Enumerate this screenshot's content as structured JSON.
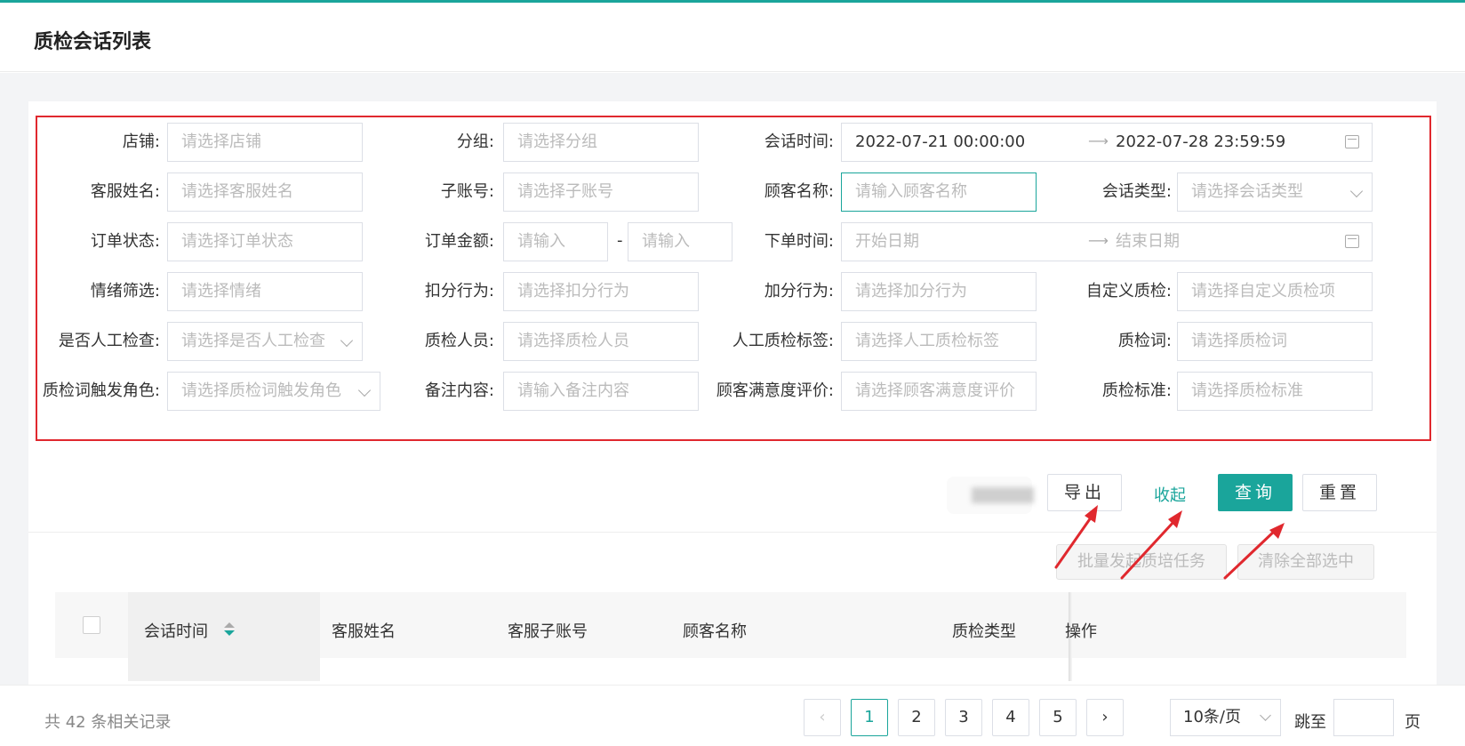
{
  "page": {
    "title": "质检会话列表"
  },
  "filters": [
    {
      "id": "shop",
      "label": "店铺:",
      "placeholder": "请选择店铺"
    },
    {
      "id": "group",
      "label": "分组:",
      "placeholder": "请选择分组"
    },
    {
      "id": "session_time",
      "label": "会话时间:",
      "start": "2022-07-21 00:00:00",
      "end": "2022-07-28 23:59:59"
    },
    {
      "id": "agent_name",
      "label": "客服姓名:",
      "placeholder": "请选择客服姓名"
    },
    {
      "id": "sub_account",
      "label": "子账号:",
      "placeholder": "请选择子账号"
    },
    {
      "id": "customer_name",
      "label": "顾客名称:",
      "placeholder": "请输入顾客名称"
    },
    {
      "id": "session_type",
      "label": "会话类型:",
      "placeholder": "请选择会话类型"
    },
    {
      "id": "order_status",
      "label": "订单状态:",
      "placeholder": "请选择订单状态"
    },
    {
      "id": "order_amount",
      "label": "订单金额:",
      "min_placeholder": "请输入",
      "max_placeholder": "请输入",
      "sep": "-"
    },
    {
      "id": "order_time",
      "label": "下单时间:",
      "start_placeholder": "开始日期",
      "end_placeholder": "结束日期"
    },
    {
      "id": "emotion",
      "label": "情绪筛选:",
      "placeholder": "请选择情绪"
    },
    {
      "id": "deduct",
      "label": "扣分行为:",
      "placeholder": "请选择扣分行为"
    },
    {
      "id": "bonus",
      "label": "加分行为:",
      "placeholder": "请选择加分行为"
    },
    {
      "id": "custom_qc",
      "label": "自定义质检:",
      "placeholder": "请选择自定义质检项"
    },
    {
      "id": "manual_check",
      "label": "是否人工检查:",
      "placeholder": "请选择是否人工检查"
    },
    {
      "id": "qc_staff",
      "label": "质检人员:",
      "placeholder": "请选择质检人员"
    },
    {
      "id": "manual_tag",
      "label": "人工质检标签:",
      "placeholder": "请选择人工质检标签"
    },
    {
      "id": "qc_word",
      "label": "质检词:",
      "placeholder": "请选择质检词"
    },
    {
      "id": "trigger_role",
      "label": "质检词触发角色:",
      "placeholder": "请选择质检词触发角色"
    },
    {
      "id": "remark",
      "label": "备注内容:",
      "placeholder": "请输入备注内容"
    },
    {
      "id": "satisfaction",
      "label": "顾客满意度评价:",
      "placeholder": "请选择顾客满意度评价"
    },
    {
      "id": "qc_standard",
      "label": "质检标准:",
      "placeholder": "请选择质检标准"
    }
  ],
  "actions": {
    "export": "导出",
    "collapse": "收起",
    "query": "查询",
    "reset": "重置"
  },
  "bulk": {
    "batch_training": "批量发起质培任务",
    "clear_selection": "清除全部选中"
  },
  "table": {
    "columns": [
      "会话时间",
      "客服姓名",
      "客服子账号",
      "顾客名称",
      "质检类型",
      "操作"
    ]
  },
  "pagination": {
    "total_text": "共 42 条相关记录",
    "pages": [
      "1",
      "2",
      "3",
      "4",
      "5"
    ],
    "current": "1",
    "page_size": "10条/页",
    "jump_label": "跳至",
    "page_unit": "页",
    "prev": "‹",
    "next": "›"
  },
  "colors": {
    "accent": "#1aa59b",
    "annotation": "#e0282e"
  }
}
